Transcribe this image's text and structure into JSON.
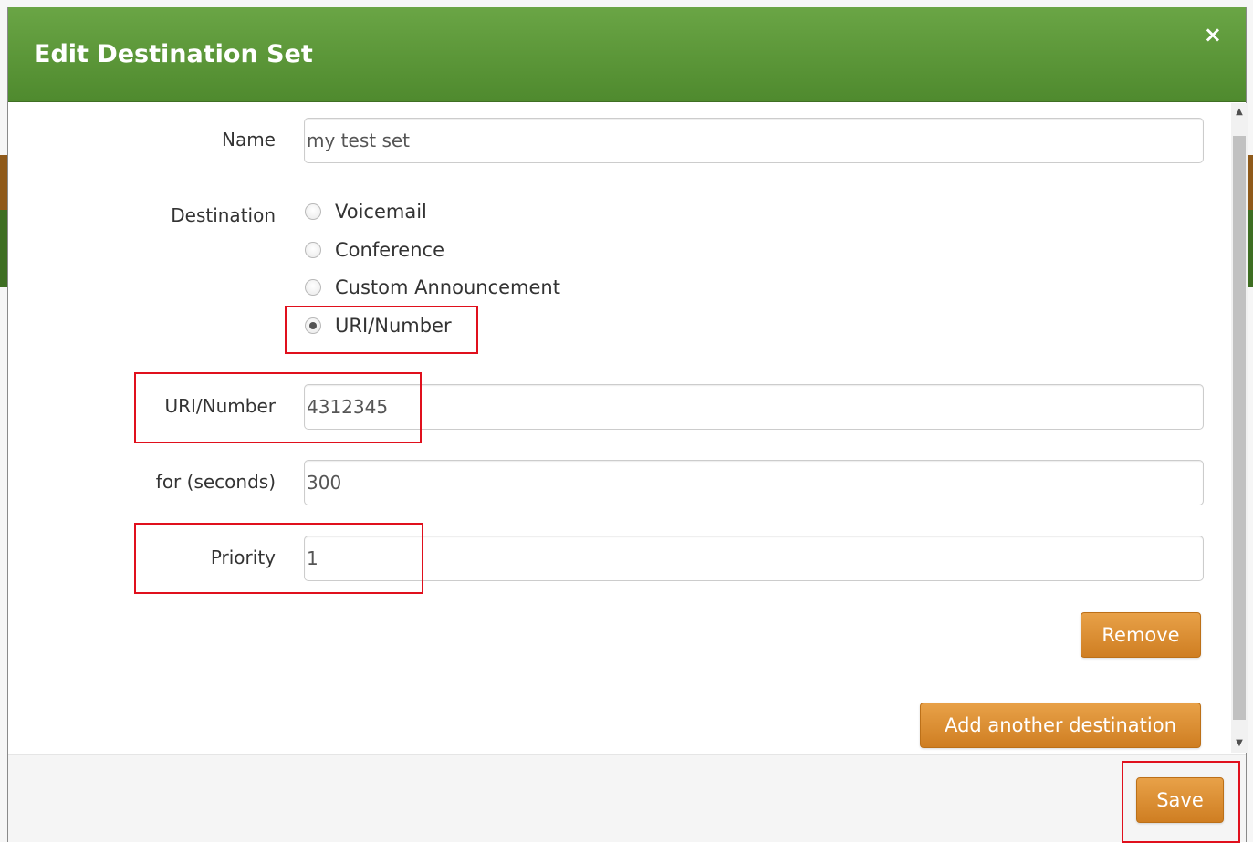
{
  "dialog": {
    "title": "Edit Destination Set",
    "close_glyph": "×"
  },
  "form": {
    "name_label": "Name",
    "name_value": "my test set",
    "destination_label": "Destination",
    "destination_options": [
      "Voicemail",
      "Conference",
      "Custom Announcement",
      "URI/Number"
    ],
    "destination_selected": "URI/Number",
    "uri_label": "URI/Number",
    "uri_value": "4312345",
    "seconds_label": "for (seconds)",
    "seconds_value": "300",
    "priority_label": "Priority",
    "priority_value": "1"
  },
  "buttons": {
    "remove": "Remove",
    "add_destination": "Add another destination",
    "save": "Save"
  },
  "colors": {
    "header_green": "#5a9739",
    "button_orange": "#dc8f33",
    "highlight_red": "#e0101d"
  },
  "icons": {
    "close": "close-icon",
    "scroll_up": "scroll-up-arrow-icon",
    "scroll_down": "scroll-down-arrow-icon"
  }
}
